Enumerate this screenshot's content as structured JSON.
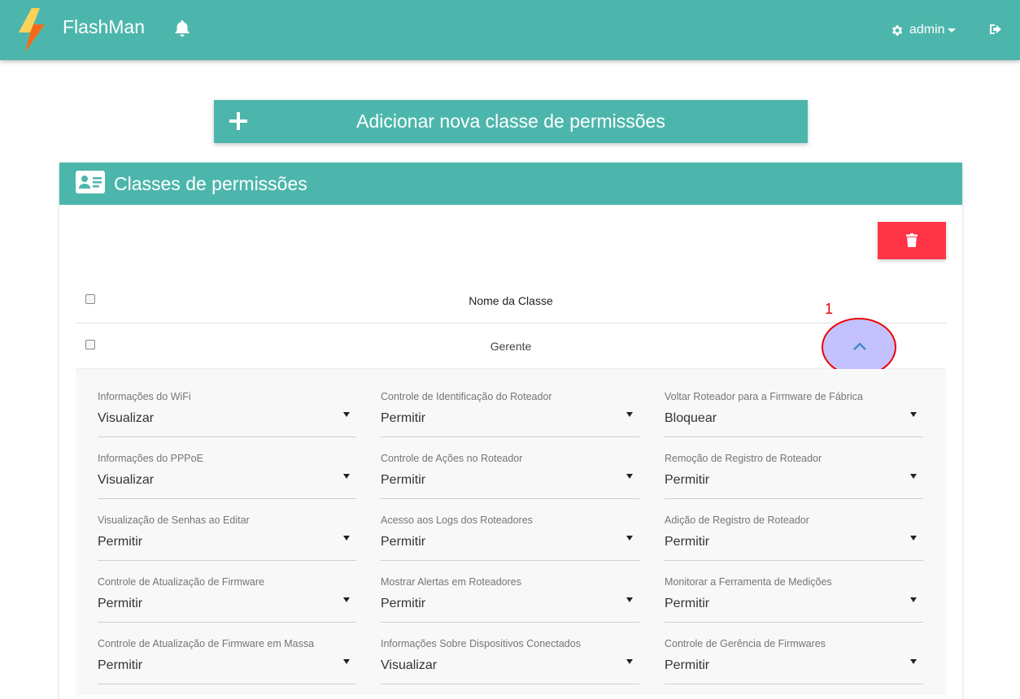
{
  "navbar": {
    "brand": "FlashMan",
    "user_label": "admin"
  },
  "icons": {
    "logo": "lightning-bolt-icon",
    "bell": "bell-icon",
    "gear": "gear-icon",
    "logout": "sign-out-icon",
    "plus": "plus-icon",
    "id_card": "id-card-icon",
    "trash": "trash-icon",
    "chevron": "chevron-up-icon"
  },
  "colors": {
    "primary": "#4db6ac",
    "danger": "#ff3547",
    "annotation": "#ee0000",
    "toggle_highlight": "#c3c2ff"
  },
  "add_button": {
    "label": "Adicionar nova classe de permissões"
  },
  "card": {
    "title": "Classes de permissões"
  },
  "table": {
    "header": "Nome da Classe",
    "rows": [
      {
        "name": "Gerente"
      }
    ]
  },
  "annotation": {
    "label": "1"
  },
  "permissions": [
    [
      {
        "label": "Informações do WiFi",
        "value": "Visualizar"
      },
      {
        "label": "Controle de Identificação do Roteador",
        "value": "Permitir"
      },
      {
        "label": "Voltar Roteador para a Firmware de Fábrica",
        "value": "Bloquear"
      }
    ],
    [
      {
        "label": "Informações do PPPoE",
        "value": "Visualizar"
      },
      {
        "label": "Controle de Ações no Roteador",
        "value": "Permitir"
      },
      {
        "label": "Remoção de Registro de Roteador",
        "value": "Permitir"
      }
    ],
    [
      {
        "label": "Visualização de Senhas ao Editar",
        "value": "Permitir"
      },
      {
        "label": "Acesso aos Logs dos Roteadores",
        "value": "Permitir"
      },
      {
        "label": "Adição de Registro de Roteador",
        "value": "Permitir"
      }
    ],
    [
      {
        "label": "Controle de Atualização de Firmware",
        "value": "Permitir"
      },
      {
        "label": "Mostrar Alertas em Roteadores",
        "value": "Permitir"
      },
      {
        "label": "Monitorar a Ferramenta de Medições",
        "value": "Permitir"
      }
    ],
    [
      {
        "label": "Controle de Atualização de Firmware em Massa",
        "value": "Permitir"
      },
      {
        "label": "Informações Sobre Dispositivos Conectados",
        "value": "Visualizar"
      },
      {
        "label": "Controle de Gerência de Firmwares",
        "value": "Permitir"
      }
    ]
  ]
}
